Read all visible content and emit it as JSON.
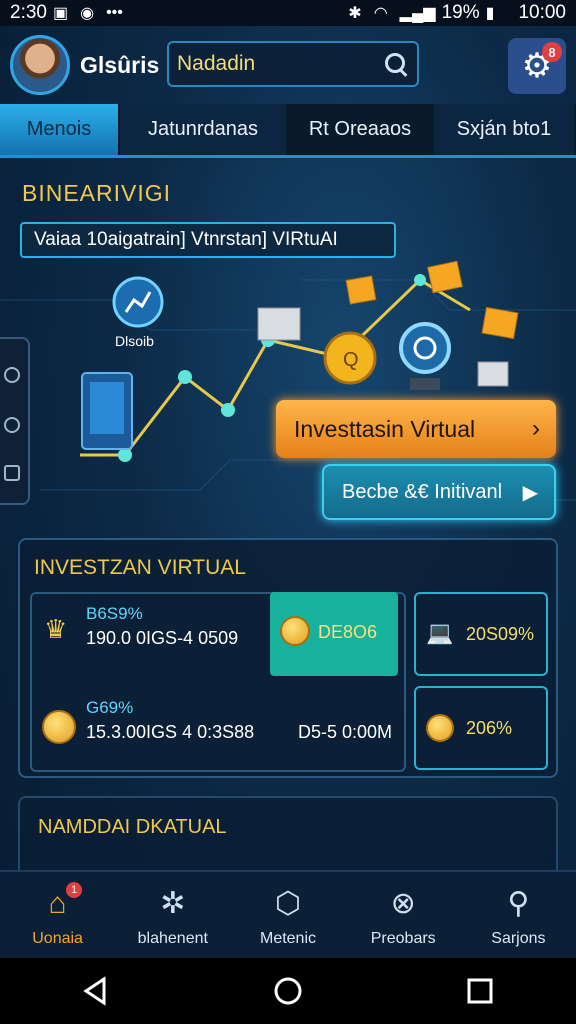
{
  "status_bar": {
    "time_left": "2:30",
    "battery": "19%",
    "time_right": "10:00"
  },
  "header": {
    "title": "Glsûris",
    "search_value": "Nadadin",
    "settings_badge": "8"
  },
  "tabs": [
    {
      "label": "Menois"
    },
    {
      "label": "Jatunrdanas"
    },
    {
      "label": "Rt Oreaaos"
    },
    {
      "label": "Sxján bto1"
    }
  ],
  "hero": {
    "heading": "BINEARIVIGI",
    "banner": "Vaiaa 10aigatrain] Vtnrstan] VIRtuAI",
    "icon_label": "Dlsoib",
    "primary_button": "Investtasin Virtual",
    "secondary_button": "Becbe &€ Initivanl"
  },
  "panel": {
    "title": "INVESTZAN VIRTUAL",
    "row1": {
      "title": "B6S9%",
      "value": "190.0 0IGS-4 0509"
    },
    "row2": {
      "title": "G69%",
      "value": "15.3.00IGS 4 0:3S88"
    },
    "teal_card": "DE8O6",
    "right_top": "20S09%",
    "mid_value": "D5-5 0:00M",
    "right_bottom": "206%"
  },
  "panel2": {
    "title": "NAMDDAI DKATUAL"
  },
  "bottom_nav": [
    {
      "label": "Uonaia",
      "icon": "home-icon",
      "badge": "1"
    },
    {
      "label": "blahenent",
      "icon": "network-icon"
    },
    {
      "label": "Metenic",
      "icon": "hex-icon"
    },
    {
      "label": "Preobars",
      "icon": "cross-circle-icon"
    },
    {
      "label": "Sarjons",
      "icon": "search-icon"
    }
  ],
  "colors": {
    "accent": "#2ab0ea",
    "gold": "#f0c84c",
    "orange": "#f5a623"
  }
}
